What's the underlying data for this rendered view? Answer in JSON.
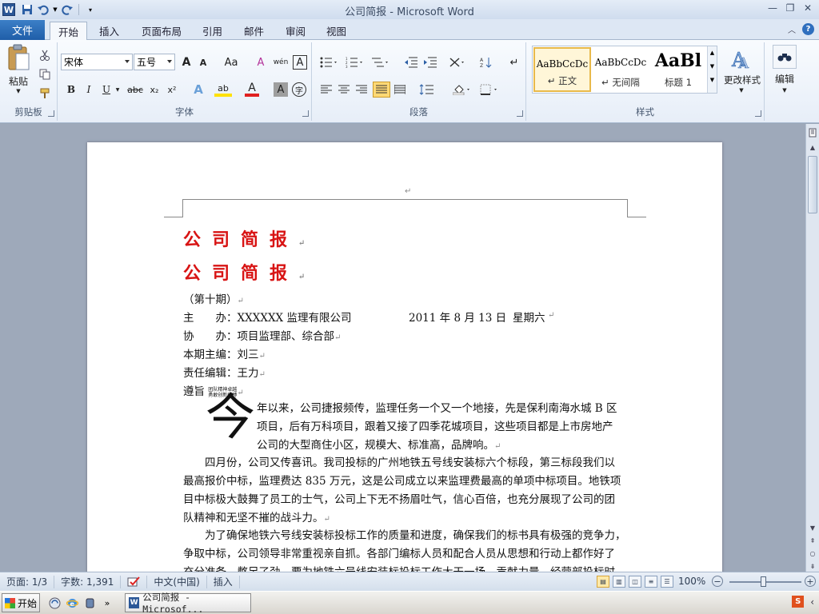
{
  "window": {
    "app_icon": "W",
    "title": "公司简报 - Microsoft Word",
    "controls": [
      "—",
      "❐",
      "✕"
    ]
  },
  "tabs": {
    "file": "文件",
    "items": [
      "开始",
      "插入",
      "页面布局",
      "引用",
      "邮件",
      "审阅",
      "视图"
    ]
  },
  "ribbon": {
    "clipboard": {
      "label": "剪贴板",
      "paste": "粘贴"
    },
    "font": {
      "label": "字体",
      "font_name": "宋体",
      "font_size": "五号",
      "grow": "A",
      "shrink": "A",
      "case": "Aa",
      "clear": "A",
      "phonetic": "wén",
      "border": "A",
      "bold": "B",
      "italic": "I",
      "underline": "U",
      "strike": "abc",
      "sub": "x₂",
      "sup": "x²",
      "highlight": "ab",
      "color": "A",
      "shade": "A",
      "encircle": "字"
    },
    "paragraph": {
      "label": "段落"
    },
    "styles": {
      "label": "样式",
      "items": [
        {
          "sample": "AaBbCcDc",
          "name": "↵ 正文"
        },
        {
          "sample": "AaBbCcDc",
          "name": "↵ 无间隔"
        },
        {
          "sample": "AaBl",
          "name": "标题 1"
        }
      ],
      "change": "更改样式"
    },
    "editing": {
      "label": "编辑"
    }
  },
  "document": {
    "para_mark": "↵",
    "titles": [
      "公司简报",
      "公司简报"
    ],
    "issue": "（第十期）",
    "host_label": "主　　办：",
    "host_value": "XXXXXX 监理有限公司",
    "date": "2011 年 8 月 13 日",
    "weekday": "星期六",
    "co_label": "协　　办：",
    "co_value": "项目监理部、综合部",
    "chief_label": "本期主编：",
    "chief_value": "刘三",
    "editor_label": "责任编辑：",
    "editor_value": "王力",
    "motto_label": "遵旨",
    "motto_line1": "团队精神卓越",
    "motto_line2": "勇敢创新拼搏",
    "dropcap": "今",
    "p1_lines": [
      "年以来，公司捷报频传，监理任务一个又一个地接，先是保利南海水城 B 区",
      "项目，后有万科项目，跟着又接了四季花城项目，这些项目都是上市房地产",
      "公司的大型商住小区，规模大、标准高，品牌响。"
    ],
    "p2_lines": [
      "　　四月份，公司又传喜讯。我司投标的广州地铁五号线安装标六个标段，第三标段我们以",
      "最高报价中标，监理费达 835 万元，这是公司成立以来监理费最高的单项中标项目。地铁项",
      "目中标极大鼓舞了员工的士气，公司上下无不扬眉吐气，信心百倍，也充分展现了公司的团",
      "队精神和无坚不摧的战斗力。"
    ],
    "p3_lines": [
      "　　为了确保地铁六号线安装标投标工作的质量和进度，确保我们的标书具有极强的竞争力，",
      "争取中标，公司领导非常重视亲自抓。各部门编标人员和配合人员从思想和行动上都作好了",
      "充分准备，憋足了劲，要为地铁六号线安装标投标工作大干一场，贡献力量。经营部投标时，"
    ]
  },
  "status": {
    "page": "页面: 1/3",
    "words": "字数: 1,391",
    "language": "中文(中国)",
    "mode": "插入",
    "zoom": "100%",
    "zoom_level_percent": 100
  },
  "taskbar": {
    "start": "开始",
    "task": "公司简报 - Microsof...",
    "tray_icon": "S",
    "expand": "»",
    "nav": "‹"
  },
  "colors": {
    "title_red": "#d81414",
    "file_tab": "#2b6bb5",
    "accent": "#2b5797"
  }
}
